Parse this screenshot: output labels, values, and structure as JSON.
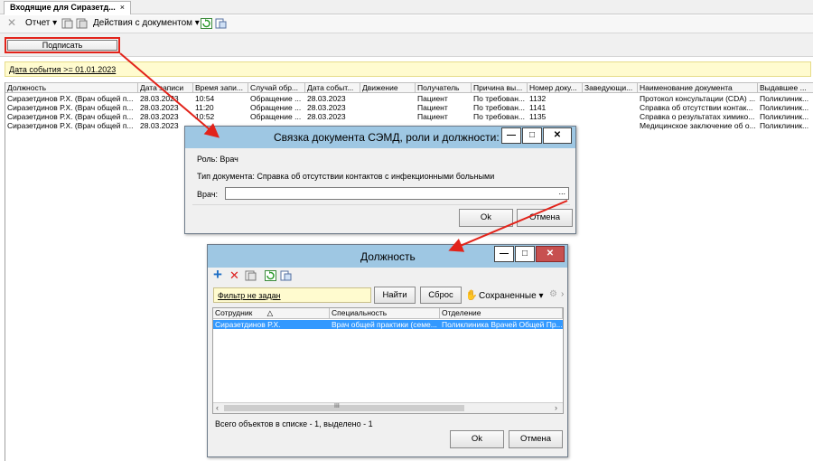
{
  "main": {
    "tab_label": "Входящие для Сиразетд...",
    "tab_close": "×",
    "toolbar": {
      "report_label": "Отчет",
      "actions_label": "Действия с документом",
      "dropdown_glyph": "▾"
    },
    "sign_button": "Подписать",
    "filter_text": "Дата события >= 01.01.2023",
    "columns": [
      "Должность",
      "Дата записи",
      "Время запи...",
      "Случай обр...",
      "Дата событ...",
      "Движение",
      "Получатель",
      "Причина вы...",
      "Номер доку...",
      "Заведующи...",
      "Наименование документа",
      "Выдавшее ..."
    ],
    "rows": [
      [
        "Сиразетдинов Р.Х. (Врач общей п...",
        "28.03.2023",
        "10:54",
        "Обращение ...",
        "28.03.2023",
        "",
        "Пациент",
        "По требован...",
        "1132",
        "",
        "Протокол консультации (CDA) ...",
        "Поликлиник..."
      ],
      [
        "Сиразетдинов Р.Х. (Врач общей п...",
        "28.03.2023",
        "11:20",
        "Обращение ...",
        "28.03.2023",
        "",
        "Пациент",
        "По требован...",
        "1141",
        "",
        "Справка об отсутствии контак...",
        "Поликлиник..."
      ],
      [
        "Сиразетдинов Р.Х. (Врач общей п...",
        "28.03.2023",
        "10:52",
        "Обращение ...",
        "28.03.2023",
        "",
        "Пациент",
        "По требован...",
        "1135",
        "",
        "Справка о результатах химико...",
        "Поликлиник..."
      ],
      [
        "Сиразетдинов Р.Х. (Врач общей п...",
        "28.03.2023",
        "",
        "",
        "",
        "",
        "",
        "",
        "",
        "",
        "Медицинское заключение об о...",
        "Поликлиник..."
      ]
    ]
  },
  "dialog1": {
    "title": "Связка документа СЭМД, роли и должности:",
    "role_text": "Роль: Врач",
    "doctype_text": "Тип документа: Справка об отсутствии контактов с инфекционными больными",
    "doctor_label": "Врач:",
    "doctor_value": "",
    "browse_label": "...",
    "ok_label": "Ok",
    "cancel_label": "Отмена",
    "min_label": "—",
    "max_label": "□",
    "close_label": "✕"
  },
  "dialog2": {
    "title": "Должность",
    "filter_text": "Фильтр не задан",
    "find_label": "Найти",
    "reset_label": "Сброс",
    "saved_label": "Сохраненные",
    "columns": [
      "Сотрудник",
      "Специальность",
      "Отделение"
    ],
    "sort_glyph": "△",
    "row": [
      "Сиразетдинов Р.Х.",
      "Врач общей практики (семе...",
      "Поликлиника Врачей Общей Пр..."
    ],
    "hscroll_mid": "III",
    "status_text": "Всего объектов в списке - 1, выделено - 1",
    "ok_label": "Ok",
    "cancel_label": "Отмена",
    "min_label": "—",
    "max_label": "□",
    "close_label": "✕"
  },
  "colors": {
    "highlight": "#e2231a",
    "title_bar": "#9ec7e3",
    "selected_row": "#3399ff",
    "filter_bg": "#fffbcf"
  }
}
